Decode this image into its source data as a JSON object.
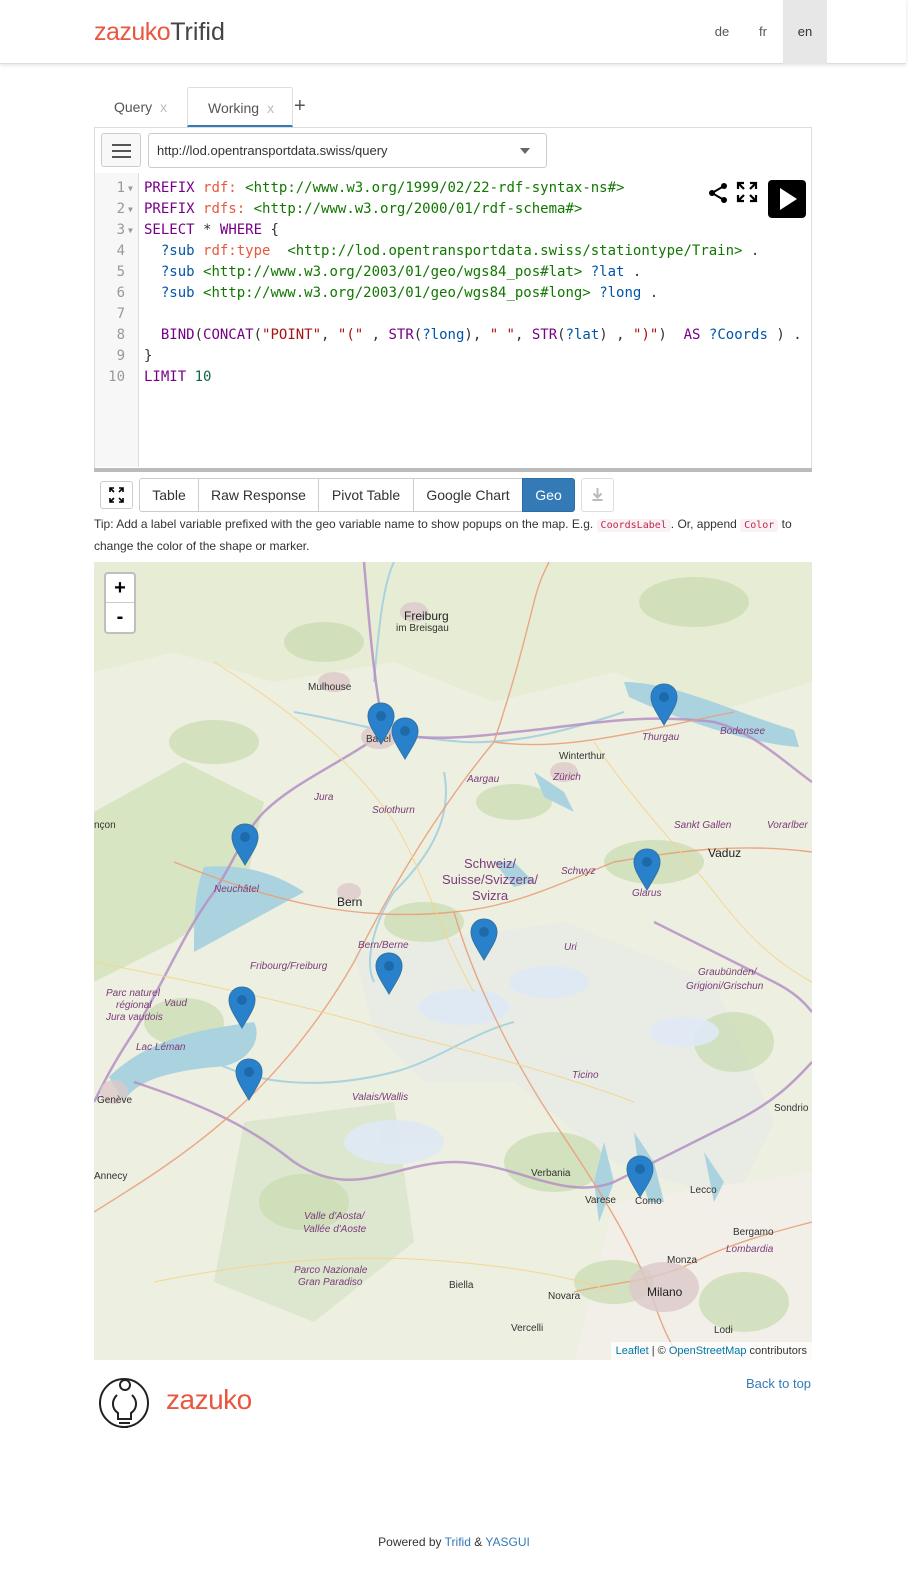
{
  "navbar": {
    "brand_part1": "zazuko",
    "brand_part2": "Trifid",
    "languages": [
      "de",
      "fr",
      "en"
    ],
    "active_language": "en"
  },
  "tabs": [
    {
      "label": "Query",
      "close": "x"
    },
    {
      "label": "Working",
      "close": "x"
    }
  ],
  "tab_add": "+",
  "endpoint": "http://lod.opentransportdata.swiss/query",
  "code_lines": [
    "1",
    "2",
    "3",
    "4",
    "5",
    "6",
    "7",
    "8",
    "9",
    "10"
  ],
  "query": {
    "l1": [
      "PREFIX",
      "rdf:",
      "<http://www.w3.org/1999/02/22-rdf-syntax-ns#>"
    ],
    "l2": [
      "PREFIX",
      "rdfs:",
      "<http://www.w3.org/2000/01/rdf-schema#>"
    ],
    "l3": [
      "SELECT",
      "*",
      "WHERE",
      "{"
    ],
    "l4": [
      "?sub",
      "rdf:type",
      "<http://lod.opentransportdata.swiss/stationtype/Train>",
      "."
    ],
    "l5": [
      "?sub",
      "<http://www.w3.org/2003/01/geo/wgs84_pos#lat>",
      "?lat",
      "."
    ],
    "l6": [
      "?sub",
      "<http://www.w3.org/2003/01/geo/wgs84_pos#long>",
      "?long",
      "."
    ],
    "l8": [
      "BIND",
      "(",
      "CONCAT",
      "(",
      "\"POINT\"",
      ", ",
      "\"(\"",
      " , ",
      "STR",
      "(",
      "?long",
      "), ",
      "\" \"",
      ", ",
      "STR",
      "(",
      "?lat",
      ") , ",
      "\")\"",
      ")  ",
      "AS",
      " ",
      "?Coords",
      " ) ."
    ],
    "l9": [
      "}"
    ],
    "l10": [
      "LIMIT",
      "10"
    ]
  },
  "results_tabs": [
    "Table",
    "Raw Response",
    "Pivot Table",
    "Google Chart",
    "Geo"
  ],
  "active_result_tab": "Geo",
  "tip": {
    "part1": "Tip: Add a label variable prefixed with the geo variable name to show popups on the map. E.g.",
    "code1": "CoordsLabel",
    "part2": ". Or, append",
    "code2": "Color",
    "part3": "to change the color of the shape or marker."
  },
  "map": {
    "zoom_in": "+",
    "zoom_out": "-",
    "attribution": {
      "leaflet": "Leaflet",
      "sep": " | © ",
      "osm": "OpenStreetMap",
      "rest": " contributors"
    },
    "labels": {
      "freiburg": "Freiburg",
      "breisgau": "im Breisgau",
      "mulhouse": "Mulhouse",
      "basel": "Basel",
      "aargau": "Aargau",
      "zurich": "Zürich",
      "winterthur": "Winterthur",
      "thurgau": "Thurgau",
      "bodensee": "Bodensee",
      "jura": "Jura",
      "solothurn": "Solothurn",
      "sanktgallen": "Sankt Gallen",
      "vorarlberg": "Vorarlber",
      "vaduz": "Vaduz",
      "besancon": "nçon",
      "schweiz1": "Schweiz/",
      "schweiz2": "Suisse/Svizzera/",
      "schweiz3": "Svizra",
      "schwyz": "Schwyz",
      "glarus": "Glarus",
      "neuchatel": "Neuchâtel",
      "bern": "Bern",
      "bernberne": "Bern/Berne",
      "uri": "Uri",
      "fribourg": "Fribourg/Freiburg",
      "graubunden1": "Graubünden/",
      "graubunden2": "Grigioni/Grischun",
      "parc1": "Parc naturel",
      "parc2": "régional",
      "parc3": "Jura vaudois",
      "vaud": "Vaud",
      "leman": "Lac Léman",
      "ticino": "Ticino",
      "geneve": "Genève",
      "valais": "Valais/Wallis",
      "sondrio": "Sondrio",
      "annecy": "Annecy",
      "verbania": "Verbania",
      "lecco": "Lecco",
      "varese": "Varese",
      "como": "Como",
      "bergamo": "Bergamo",
      "aosta1": "Valle d'Aosta/",
      "aosta2": "Vallée d'Aoste",
      "lombardia": "Lombardia",
      "monza": "Monza",
      "gran1": "Parco Nazionale",
      "gran2": "Gran Paradiso",
      "biella": "Biella",
      "milano": "Milano",
      "novara": "Novara",
      "vercelli": "Vercelli",
      "lodi": "Lodi"
    }
  },
  "footer": {
    "brand": "zazuko",
    "back_to_top": "Back to top",
    "powered_by": "Powered by",
    "trifid": "Trifid",
    "amp": "&",
    "yasgui": "YASGUI"
  }
}
